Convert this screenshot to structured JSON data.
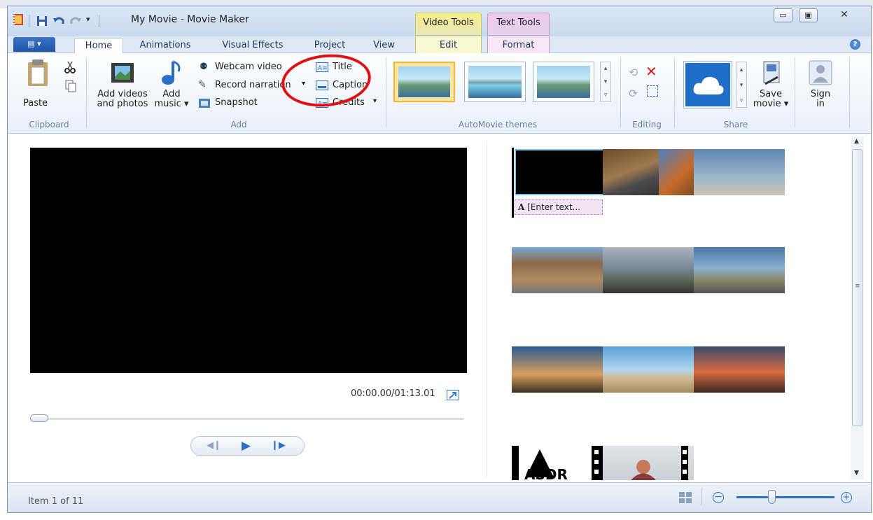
{
  "window": {
    "title": "My Movie - Movie Maker"
  },
  "context_tabs": {
    "video_tools": "Video Tools",
    "text_tools": "Text Tools"
  },
  "tabs": [
    "Home",
    "Animations",
    "Visual Effects",
    "Project",
    "View",
    "Edit",
    "Format"
  ],
  "ribbon": {
    "clipboard": {
      "paste": "Paste",
      "group": "Clipboard"
    },
    "add": {
      "add_videos_line1": "Add videos",
      "add_videos_line2": "and photos",
      "add_music_line1": "Add",
      "add_music_line2": "music",
      "webcam": "Webcam video",
      "record": "Record narration",
      "snapshot": "Snapshot",
      "title": "Title",
      "caption": "Caption",
      "credits": "Credits",
      "group": "Add"
    },
    "themes": {
      "group": "AutoMovie themes"
    },
    "editing": {
      "group": "Editing"
    },
    "share": {
      "save_line1": "Save",
      "save_line2": "movie",
      "signin_line1": "Sign",
      "signin_line2": "in",
      "group": "Share"
    }
  },
  "preview": {
    "timecode": "00:00.00/01:13.01"
  },
  "storyboard": {
    "text_caption": "[Enter text..."
  },
  "status": {
    "item": "Item 1 of 11"
  },
  "colors": {
    "accent_red": "#e01010",
    "ribbon_blue": "#1f56a7",
    "video_tools": "#f6f08a",
    "text_tools": "#f0c8ee"
  }
}
